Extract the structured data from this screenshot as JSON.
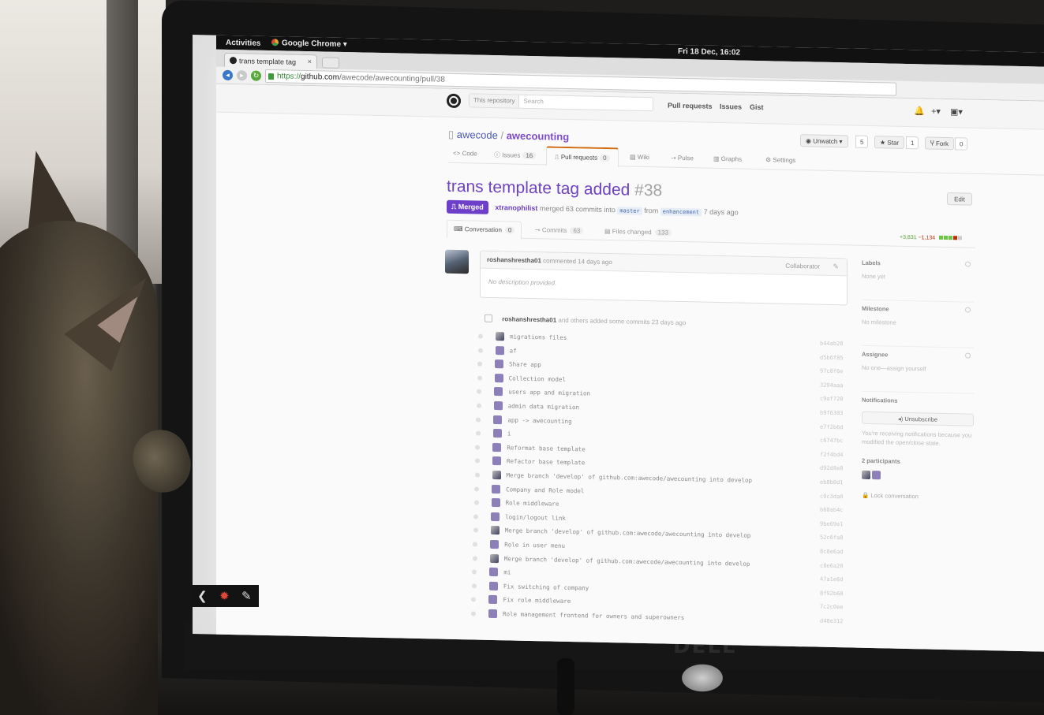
{
  "gnome": {
    "activities": "Activities",
    "app": "Google Chrome ▾",
    "clock": "Fri 18 Dec, 16:02"
  },
  "browser": {
    "tab_title": "trans template tag",
    "tab_close": "×",
    "url_scheme": "https://",
    "url_host": "github.com",
    "url_path": "/awecode/awecounting/pull/38"
  },
  "header": {
    "search_scope": "This repository",
    "search_placeholder": "Search",
    "nav": [
      "Pull requests",
      "Issues",
      "Gist"
    ]
  },
  "repo": {
    "owner": "awecode",
    "separator": "/",
    "name": "awecounting",
    "unwatch_label": "◉ Unwatch ▾",
    "unwatch_count": "5",
    "star_label": "★ Star",
    "star_count": "1",
    "fork_label": "Ⴤ Fork",
    "fork_count": "0",
    "tabs": [
      {
        "label": "<> Code",
        "count": ""
      },
      {
        "label": "ⓘ Issues",
        "count": "16"
      },
      {
        "label": "⎍ Pull requests",
        "count": "0"
      },
      {
        "label": "▤ Wiki",
        "count": ""
      },
      {
        "label": "⇢ Pulse",
        "count": ""
      },
      {
        "label": "▥ Graphs",
        "count": ""
      },
      {
        "label": "⚙ Settings",
        "count": ""
      }
    ]
  },
  "pr": {
    "title": "trans template tag added",
    "number": "#38",
    "edit_label": "Edit",
    "state": "⎍ Merged",
    "author": "xtranophilist",
    "meta_merged": "merged 63 commits into",
    "base_branch": "master",
    "meta_from": "from",
    "head_branch": "enhancement",
    "meta_ago": "7 days ago",
    "tabs": [
      {
        "label": "⌨ Conversation",
        "count": "0"
      },
      {
        "label": "⊸ Commits",
        "count": "63"
      },
      {
        "label": "▤ Files changed",
        "count": "133"
      }
    ],
    "additions": "+3,831",
    "deletions": "−1,134"
  },
  "comment": {
    "author": "roshanshrestha01",
    "when": "commented 14 days ago",
    "role": "Collaborator",
    "body": "No description provided."
  },
  "timeline": {
    "author": "roshanshrestha01",
    "text": "and others added some commits 23 days ago"
  },
  "commits": [
    "migrations files",
    "af",
    "Share app",
    "Collection model",
    "users app and migration",
    "admin data migration",
    "app -> awecounting",
    "i",
    "Reformat base template",
    "Refactor base template",
    "Merge branch 'develop' of github.com:awecode/awecounting into develop",
    "Company and Role model",
    "Role middleware",
    "login/logout link",
    "Merge branch 'develop' of github.com:awecode/awecounting into develop",
    "Role in user menu",
    "Merge branch 'develop' of github.com:awecode/awecounting into develop",
    "mi",
    "Fix switching of company",
    "Fix role middleware",
    "Role management frontend for owners and superowners"
  ],
  "shas": [
    "b44ab28",
    "d5b6f85",
    "97c0f6e",
    "3294aaa",
    "c9af720",
    "b9f6303",
    "e7f2b6d",
    "c6747bc",
    "f2f4bd4",
    "d92d8e8",
    "eb8b0d1",
    "c0c3da0",
    "b60ab4c",
    "9be69e1",
    "52c6fa8",
    "8c8e6ad",
    "c8e6a20",
    "47a1e6d",
    "8f92b60",
    "7c2c0ee",
    "d48e312"
  ],
  "sidebar": {
    "labels_h": "Labels",
    "labels_v": "None yet",
    "milestone_h": "Milestone",
    "milestone_v": "No milestone",
    "assignee_h": "Assignee",
    "assignee_v": "No one—assign yourself",
    "notifications_h": "Notifications",
    "unsubscribe": "◂) Unsubscribe",
    "notifications_note": "You're receiving notifications because you modified the open/close state.",
    "participants_h": "2 participants",
    "lock": "🔒 Lock conversation"
  },
  "monitor": {
    "brand": "DELL"
  }
}
